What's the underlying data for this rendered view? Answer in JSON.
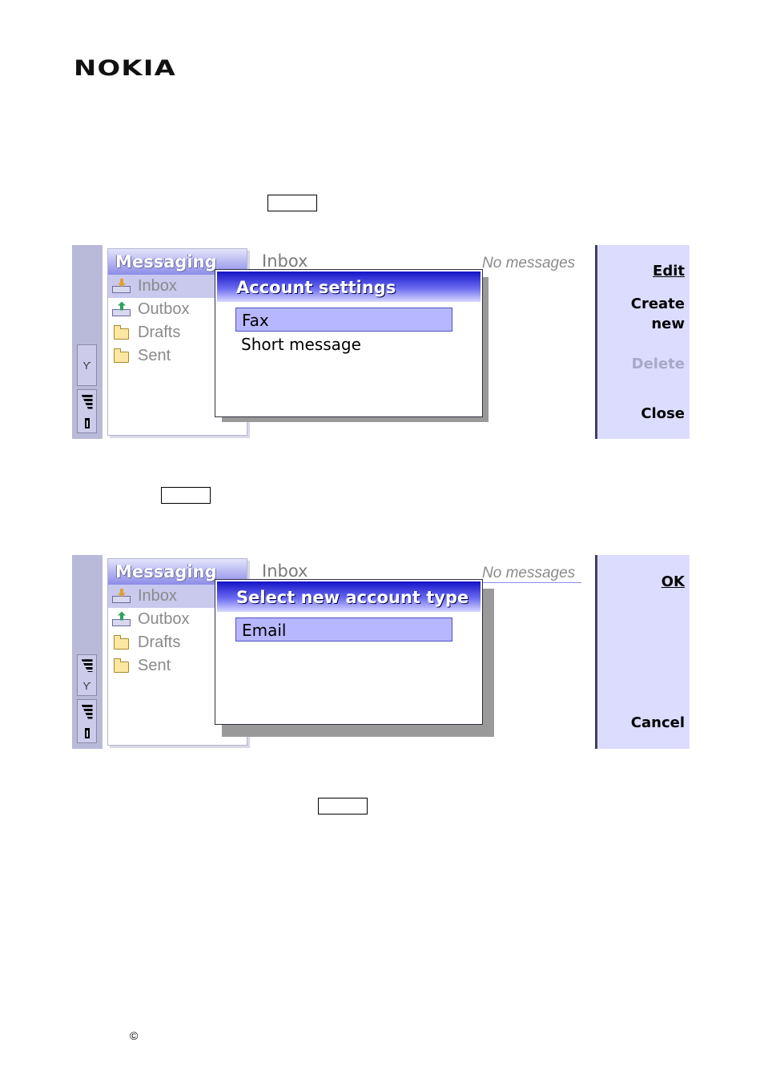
{
  "logo": "NOKIA",
  "copyright_symbol": "©",
  "screen1": {
    "sidebar_title": "Messaging",
    "folders": [
      "Inbox",
      "Outbox",
      "Drafts",
      "Sent"
    ],
    "view_title": "Inbox",
    "status": "No messages",
    "dialog": {
      "title": "Account settings",
      "items": [
        "Fax",
        "Short message"
      ]
    },
    "commands": {
      "edit": "Edit",
      "create": "Create",
      "create2": "new",
      "delete": "Delete",
      "close": "Close"
    }
  },
  "screen2": {
    "sidebar_title": "Messaging",
    "folders": [
      "Inbox",
      "Outbox",
      "Drafts",
      "Sent"
    ],
    "view_title": "Inbox",
    "status": "No messages",
    "dialog": {
      "title": "Select new account type",
      "items": [
        "Email"
      ]
    },
    "commands": {
      "ok": "OK",
      "cancel": "Cancel"
    }
  },
  "colors": {
    "accent": "#8c8ce8",
    "selection": "#b7b7ff",
    "command_bg": "#dcdcff"
  }
}
